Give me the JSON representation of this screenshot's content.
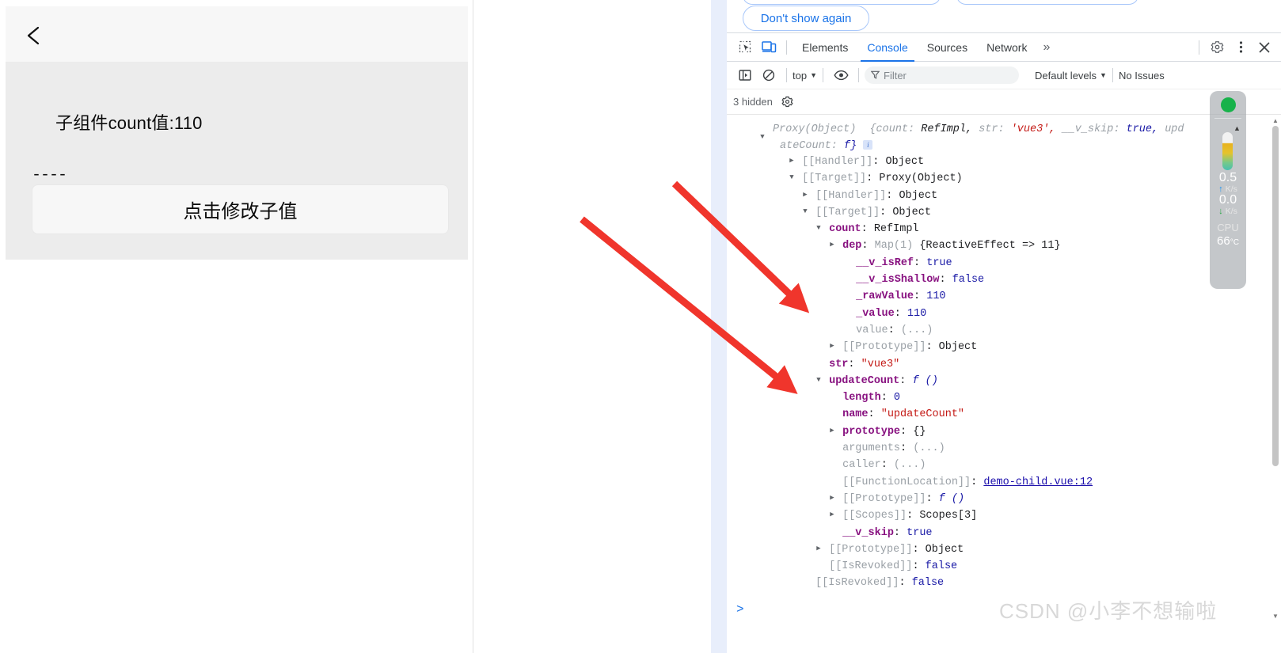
{
  "app_preview": {
    "back_icon": "chevron-left-icon",
    "count_label": "子组件count值:110",
    "divider_text": "----",
    "button_label": "点击修改子值"
  },
  "devtools": {
    "notification": {
      "dont_show_again": "Don't show again"
    },
    "toolbar": {
      "inspect_icon": "inspect-element-icon",
      "device_icon": "device-toolbar-icon",
      "tabs": [
        {
          "label": "Elements",
          "active": false
        },
        {
          "label": "Console",
          "active": true
        },
        {
          "label": "Sources",
          "active": false
        },
        {
          "label": "Network",
          "active": false
        }
      ],
      "more_tabs": "»",
      "settings_icon": "gear-icon",
      "menu_icon": "kebab-menu-icon",
      "close_icon": "close-icon"
    },
    "filterbar": {
      "sidebar_icon": "console-sidebar-icon",
      "clear_icon": "clear-console-icon",
      "context": "top",
      "eye_icon": "live-expression-eye-icon",
      "filter_icon": "filter-funnel-icon",
      "filter_placeholder": "Filter",
      "levels": "Default levels",
      "issues": "No Issues"
    },
    "hiddenbar": {
      "hidden_count": "3 hidden",
      "settings_icon": "gear-icon"
    },
    "console": {
      "first_line": {
        "type": "Proxy(Object)",
        "preview_open": "{",
        "p1_key": "count:",
        "p1_val": "RefImpl,",
        "p2_key": "str:",
        "p2_val": "'vue3',",
        "p3_key": "__v_skip:",
        "p3_val": "true,",
        "p4_key": "upd",
        "wrap_key": "ateCount:",
        "wrap_val": "f}",
        "info_badge": "i"
      },
      "rows": [
        {
          "indent": 1,
          "arrow": "closed",
          "key": "[[Handler]]",
          "keyclass": "key-dim",
          "sep": ": ",
          "value": "Object",
          "valclass": "val-obj"
        },
        {
          "indent": 1,
          "arrow": "open",
          "key": "[[Target]]",
          "keyclass": "key-dim",
          "sep": ": ",
          "value": "Proxy(Object)",
          "valclass": "val-obj"
        },
        {
          "indent": 2,
          "arrow": "closed",
          "key": "[[Handler]]",
          "keyclass": "key-dim",
          "sep": ": ",
          "value": "Object",
          "valclass": "val-obj"
        },
        {
          "indent": 2,
          "arrow": "open",
          "key": "[[Target]]",
          "keyclass": "key-dim",
          "sep": ": ",
          "value": "Object",
          "valclass": "val-obj"
        },
        {
          "indent": 3,
          "arrow": "open",
          "key": "count",
          "keyclass": "key",
          "sep": ": ",
          "value": "RefImpl",
          "valclass": "val-obj"
        },
        {
          "indent": 4,
          "arrow": "closed",
          "key": "dep",
          "keyclass": "key",
          "sep": ": ",
          "value": "Map(1)",
          "valclass": "val-dim",
          "extra": "{ReactiveEffect => 11}",
          "extraclass": "val-obj"
        },
        {
          "indent": 5,
          "arrow": "none",
          "key": "__v_isRef",
          "keyclass": "key",
          "sep": ": ",
          "value": "true",
          "valclass": "val-bool"
        },
        {
          "indent": 5,
          "arrow": "none",
          "key": "__v_isShallow",
          "keyclass": "key",
          "sep": ": ",
          "value": "false",
          "valclass": "val-bool"
        },
        {
          "indent": 5,
          "arrow": "none",
          "key": "_rawValue",
          "keyclass": "key",
          "sep": ": ",
          "value": "110",
          "valclass": "val-num"
        },
        {
          "indent": 5,
          "arrow": "none",
          "key": "_value",
          "keyclass": "key",
          "sep": ": ",
          "value": "110",
          "valclass": "val-num"
        },
        {
          "indent": 5,
          "arrow": "none",
          "key": "value",
          "keyclass": "key-dim",
          "sep": ": ",
          "value": "(...)",
          "valclass": "val-dim"
        },
        {
          "indent": 4,
          "arrow": "closed",
          "key": "[[Prototype]]",
          "keyclass": "key-dim",
          "sep": ": ",
          "value": "Object",
          "valclass": "val-obj"
        },
        {
          "indent": 3,
          "arrow": "none",
          "key": "str",
          "keyclass": "key",
          "sep": ": ",
          "value": "\"vue3\"",
          "valclass": "val-str"
        },
        {
          "indent": 3,
          "arrow": "open",
          "key": "updateCount",
          "keyclass": "key",
          "sep": ": ",
          "value": "f ()",
          "valclass": "val-fn"
        },
        {
          "indent": 4,
          "arrow": "none",
          "key": "length",
          "keyclass": "key",
          "sep": ": ",
          "value": "0",
          "valclass": "val-num"
        },
        {
          "indent": 4,
          "arrow": "none",
          "key": "name",
          "keyclass": "key",
          "sep": ": ",
          "value": "\"updateCount\"",
          "valclass": "val-str"
        },
        {
          "indent": 4,
          "arrow": "closed",
          "key": "prototype",
          "keyclass": "key",
          "sep": ": ",
          "value": "{}",
          "valclass": "val-obj"
        },
        {
          "indent": 4,
          "arrow": "none",
          "key": "arguments",
          "keyclass": "key-dim",
          "sep": ": ",
          "value": "(...)",
          "valclass": "val-dim"
        },
        {
          "indent": 4,
          "arrow": "none",
          "key": "caller",
          "keyclass": "key-dim",
          "sep": ": ",
          "value": "(...)",
          "valclass": "val-dim"
        },
        {
          "indent": 4,
          "arrow": "none",
          "key": "[[FunctionLocation]]",
          "keyclass": "key-dim",
          "sep": ": ",
          "value": "demo-child.vue:12",
          "valclass": "link"
        },
        {
          "indent": 4,
          "arrow": "closed",
          "key": "[[Prototype]]",
          "keyclass": "key-dim",
          "sep": ": ",
          "value": "f ()",
          "valclass": "val-fn"
        },
        {
          "indent": 4,
          "arrow": "closed",
          "key": "[[Scopes]]",
          "keyclass": "key-dim",
          "sep": ": ",
          "value": "Scopes[3]",
          "valclass": "val-obj"
        },
        {
          "indent": 4,
          "arrow": "none",
          "key": "__v_skip",
          "keyclass": "key",
          "sep": ": ",
          "value": "true",
          "valclass": "val-bool"
        },
        {
          "indent": 3,
          "arrow": "closed",
          "key": "[[Prototype]]",
          "keyclass": "key-dim",
          "sep": ": ",
          "value": "Object",
          "valclass": "val-obj"
        },
        {
          "indent": 3,
          "arrow": "none",
          "key": "[[IsRevoked]]",
          "keyclass": "key-dim",
          "sep": ": ",
          "value": "false",
          "valclass": "val-bool"
        },
        {
          "indent": 2,
          "arrow": "none",
          "key": "[[IsRevoked]]",
          "keyclass": "key-dim",
          "sep": ": ",
          "value": "false",
          "valclass": "val-bool"
        }
      ],
      "prompt_caret": ">"
    }
  },
  "net_monitor": {
    "status_dot_color": "#17b24a",
    "upload_value": "0.5",
    "upload_unit": "K/s",
    "download_value": "0.0",
    "download_unit": "K/s",
    "cpu_label": "CPU",
    "cpu_temp": "66",
    "cpu_temp_unit": "°C"
  },
  "watermark": "CSDN @小李不想输啦"
}
